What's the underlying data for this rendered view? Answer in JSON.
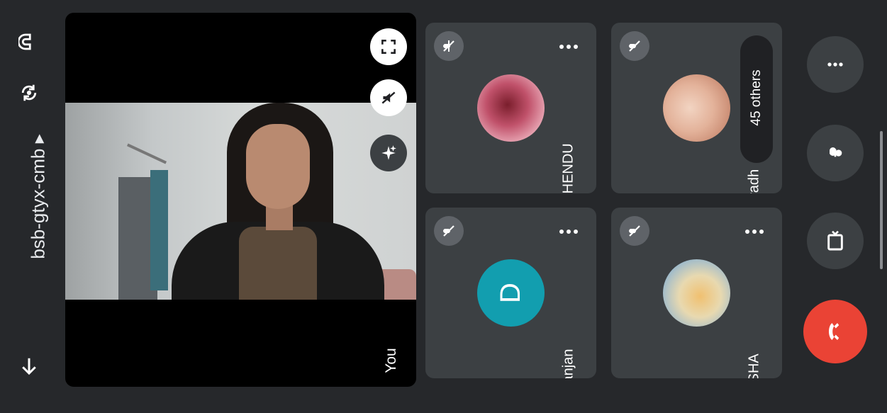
{
  "meeting": {
    "code": "bsb-gtyx-cmb ▸",
    "self_label": "You"
  },
  "left_rail": {
    "top_icon": "headset-audio-icon",
    "switch_icon": "camera-switch-icon",
    "bottom_icon": "back-arrow-icon"
  },
  "self_controls": [
    "fullscreen-icon",
    "mic-off-icon",
    "effects-sparkle-icon"
  ],
  "participants": [
    {
      "name": "SUBHENDU",
      "muted": true,
      "avatar": "photo"
    },
    {
      "name": "Anuradh",
      "muted": true,
      "avatar": "photo"
    },
    {
      "name": "Dipanjan",
      "muted": true,
      "avatar": "letter",
      "initial": "D",
      "avatar_color": "#129eaf"
    },
    {
      "name": "TIASHA",
      "muted": true,
      "avatar": "photo"
    }
  ],
  "others_badge": "45 others",
  "controls": [
    {
      "icon": "more-options-icon"
    },
    {
      "icon": "microphone-icon"
    },
    {
      "icon": "cast-icon"
    },
    {
      "icon": "end-call-icon",
      "color": "#ea4335"
    }
  ]
}
